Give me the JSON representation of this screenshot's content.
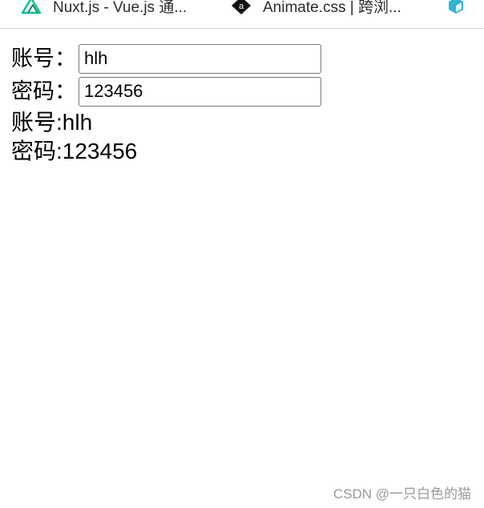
{
  "bookmarks": [
    {
      "title": "Nuxt.js - Vue.js 通...",
      "icon": "nuxt-logo-icon",
      "icon_color": "#00c58e"
    },
    {
      "title": "Animate.css | 跨浏...",
      "icon": "animate-logo-icon",
      "icon_color": "#000000"
    },
    {
      "title": "",
      "icon": "cube-icon",
      "icon_color": "#2fb5d3"
    }
  ],
  "form": {
    "account_label": "账号：",
    "account_value": "hlh",
    "password_label": "密码：",
    "password_value": "123456"
  },
  "echo": {
    "account_text": "账号:hlh",
    "password_text": "密码:123456"
  },
  "watermark": "CSDN @一只白色的猫"
}
